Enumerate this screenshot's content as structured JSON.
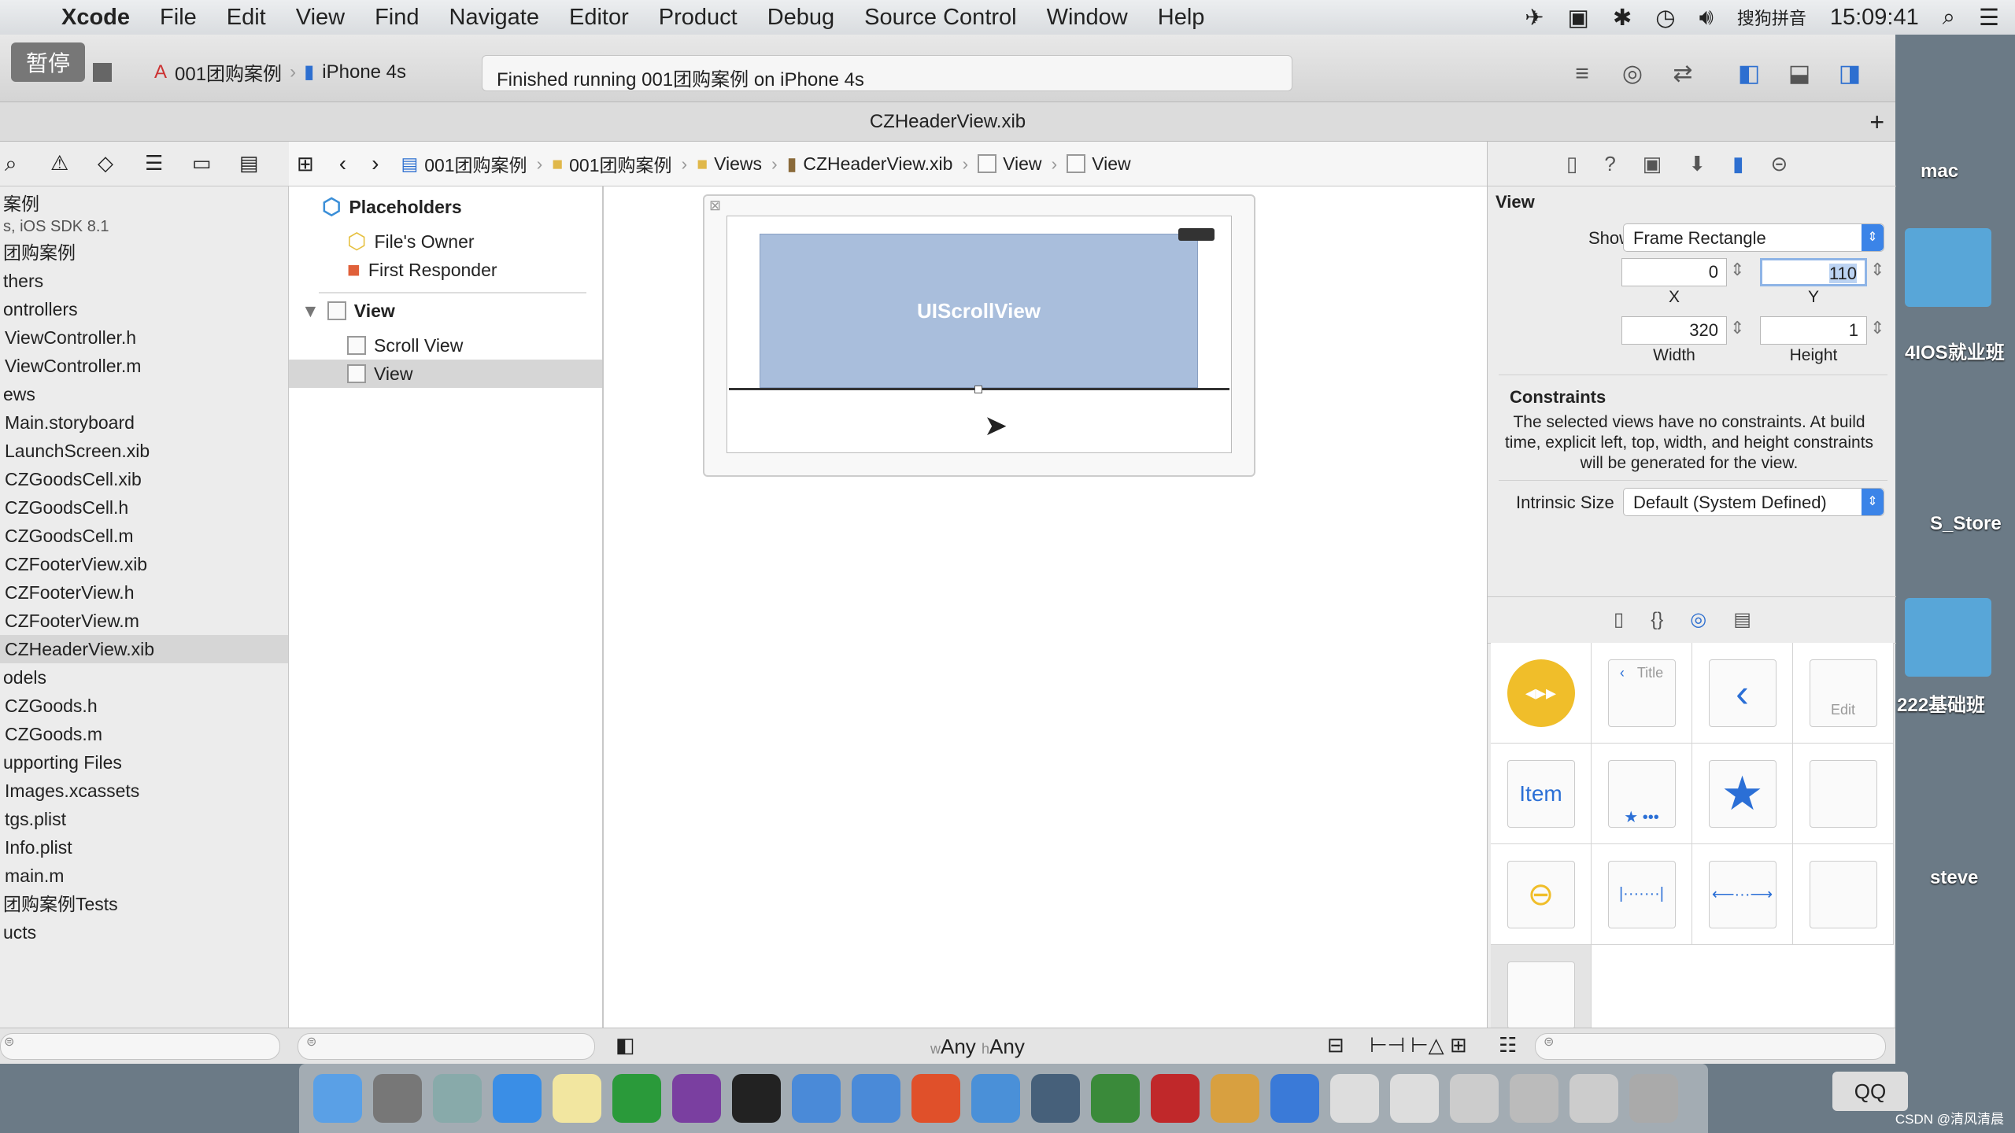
{
  "menubar": {
    "apple": "",
    "app": "Xcode",
    "items": [
      "File",
      "Edit",
      "View",
      "Find",
      "Navigate",
      "Editor",
      "Product",
      "Debug",
      "Source Control",
      "Window",
      "Help"
    ],
    "ime": "搜狗拼音",
    "clock": "15:09:41"
  },
  "toolbar": {
    "pause": "暂停",
    "project": "001团购案例",
    "device": "iPhone 4s",
    "status": "Finished running 001团购案例 on iPhone 4s"
  },
  "tab": {
    "title": "CZHeaderView.xib"
  },
  "jumpbar": [
    "001团购案例",
    "001团购案例",
    "Views",
    "CZHeaderView.xib",
    "View",
    "View"
  ],
  "navigator": {
    "items": [
      {
        "label": "案例",
        "type": "group"
      },
      {
        "label": "s, iOS SDK 8.1",
        "type": "sub"
      },
      {
        "label": "团购案例",
        "type": "group"
      },
      {
        "label": "thers",
        "type": "group"
      },
      {
        "label": "ontrollers",
        "type": "group"
      },
      {
        "label": "ViewController.h"
      },
      {
        "label": "ViewController.m"
      },
      {
        "label": "ews",
        "type": "group"
      },
      {
        "label": "Main.storyboard"
      },
      {
        "label": "LaunchScreen.xib"
      },
      {
        "label": "CZGoodsCell.xib"
      },
      {
        "label": "CZGoodsCell.h"
      },
      {
        "label": "CZGoodsCell.m"
      },
      {
        "label": "CZFooterView.xib"
      },
      {
        "label": "CZFooterView.h"
      },
      {
        "label": "CZFooterView.m"
      },
      {
        "label": "CZHeaderView.xib",
        "selected": true
      },
      {
        "label": "odels",
        "type": "group"
      },
      {
        "label": "CZGoods.h"
      },
      {
        "label": "CZGoods.m"
      },
      {
        "label": "upporting Files",
        "type": "group"
      },
      {
        "label": "Images.xcassets"
      },
      {
        "label": "tgs.plist"
      },
      {
        "label": "Info.plist"
      },
      {
        "label": "main.m"
      },
      {
        "label": "团购案例Tests",
        "type": "group"
      },
      {
        "label": "ucts",
        "type": "group"
      }
    ]
  },
  "outline": {
    "placeholders": "Placeholders",
    "files_owner": "File's Owner",
    "first_responder": "First Responder",
    "view": "View",
    "scroll_view": "Scroll View",
    "sub_view": "View"
  },
  "canvas": {
    "scroll_label": "UIScrollView",
    "size_class_w": "Any",
    "size_class_h": "Any",
    "w_prefix": "w",
    "h_prefix": "h"
  },
  "inspector": {
    "section": "View",
    "show_label": "Show",
    "show_value": "Frame Rectangle",
    "x": "0",
    "y": "110",
    "width": "320",
    "height": "1",
    "x_label": "X",
    "y_label": "Y",
    "width_label": "Width",
    "height_label": "Height",
    "constraints_title": "Constraints",
    "constraints_text": "The selected views have no constraints. At build time, explicit left, top, width, and height constraints will be generated for the view.",
    "intrinsic_label": "Intrinsic Size",
    "intrinsic_value": "Default (System Defined)"
  },
  "library": {
    "title_cell": "Title",
    "edit_cell": "Edit",
    "item_cell": "Item"
  },
  "desktop": {
    "items": [
      "mac",
      "4IOS就业班",
      "S_Store",
      "222基础班",
      "steve"
    ]
  },
  "dock": {
    "qq": "QQ",
    "watermark": "CSDN @清风清晨"
  }
}
